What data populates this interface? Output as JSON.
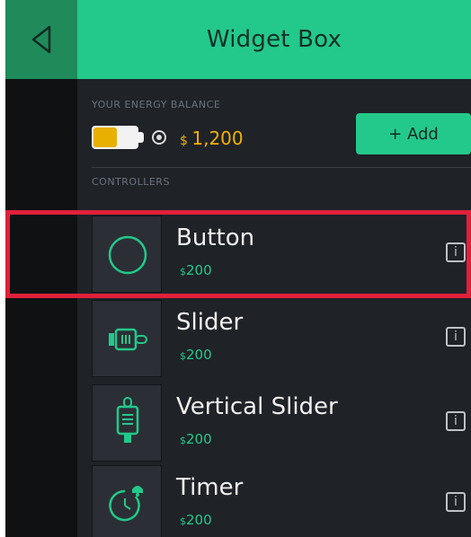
{
  "header": {
    "title": "Widget Box"
  },
  "energy": {
    "label": "YOUR ENERGY BALANCE",
    "value": "1,200",
    "add_label": "+ Add"
  },
  "controllers": {
    "label": "CONTROLLERS",
    "items": [
      {
        "name": "Button",
        "price": "200",
        "icon": "circle-icon"
      },
      {
        "name": "Slider",
        "price": "200",
        "icon": "slider-icon"
      },
      {
        "name": "Vertical Slider",
        "price": "200",
        "icon": "vertical-slider-icon"
      },
      {
        "name": "Timer",
        "price": "200",
        "icon": "timer-icon"
      }
    ]
  },
  "colors": {
    "accent": "#23c98a",
    "energy": "#f2b200",
    "highlight": "#e0203a"
  }
}
